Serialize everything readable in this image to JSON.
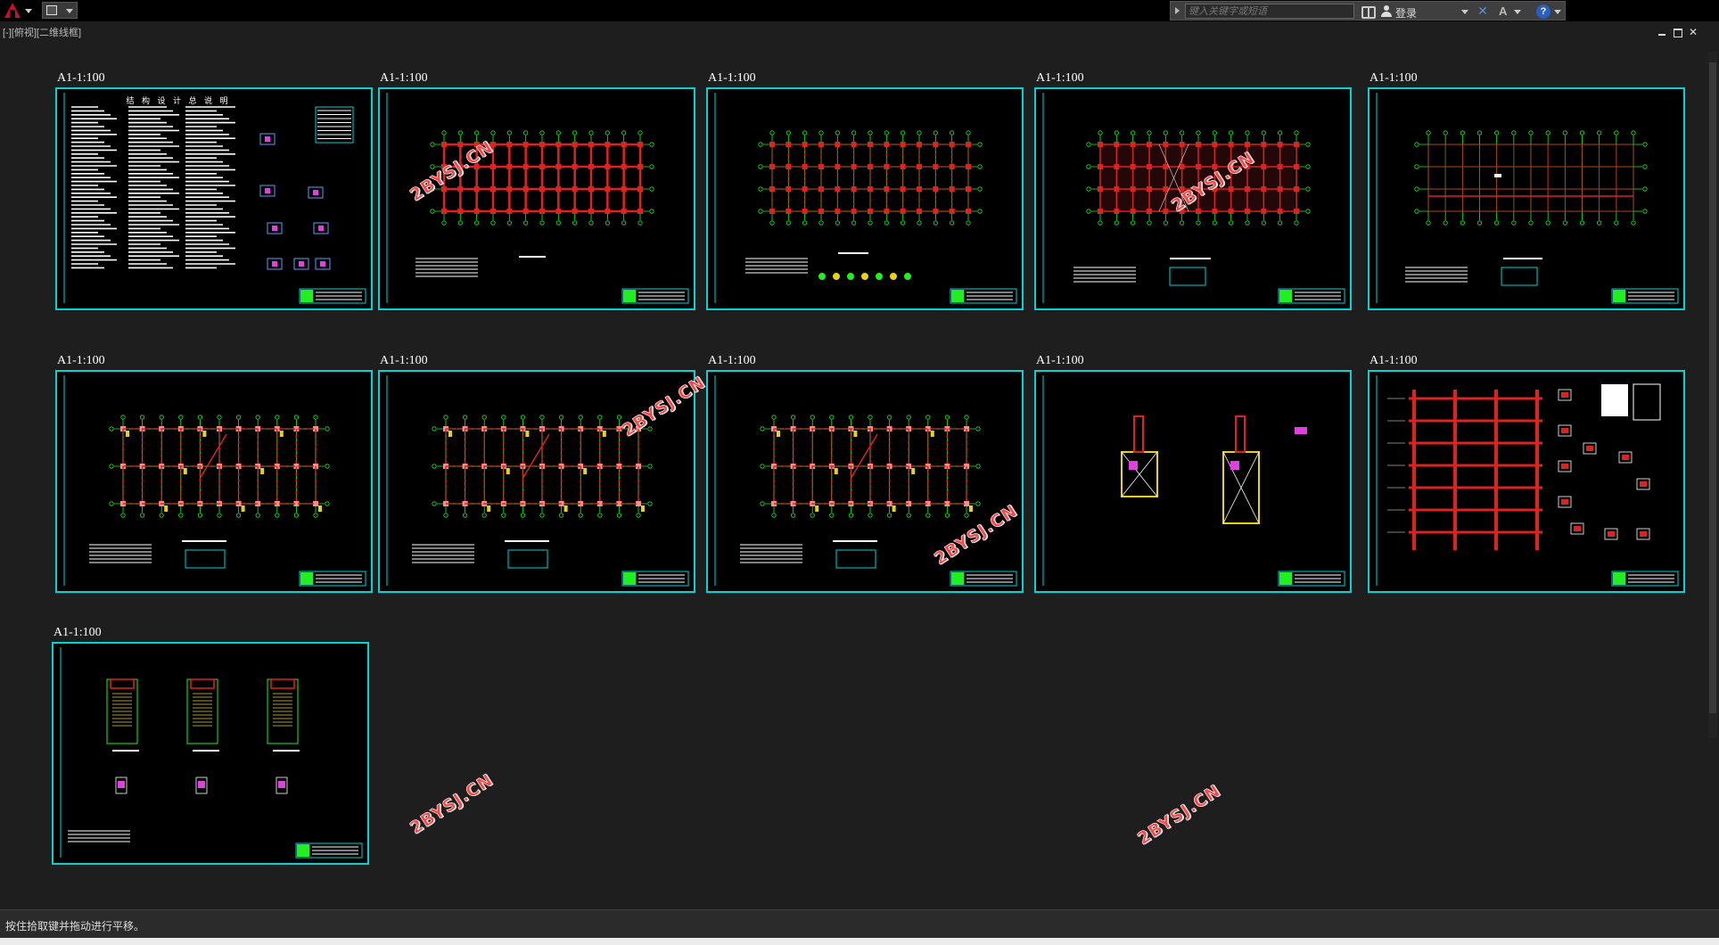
{
  "app": {
    "menu_icon": "autocad-a-logo",
    "quick_access_icon": "document-icon",
    "viewport_label": "[-][俯视][二维线框]",
    "window_controls": [
      "minimize-icon",
      "restore-icon",
      "close-icon"
    ],
    "close_glyph": "✕"
  },
  "info_center": {
    "search_placeholder": "键入关键字或短语",
    "login_label": "登录",
    "exchange_glyph": "✕",
    "a360_glyph": "A",
    "help_glyph": "?"
  },
  "sheets": [
    {
      "scale": "A1-1:100",
      "kind": "notes",
      "title": "结 构 设 计 总 说 明"
    },
    {
      "scale": "A1-1:100",
      "kind": "plan-columns"
    },
    {
      "scale": "A1-1:100",
      "kind": "plan-foundation"
    },
    {
      "scale": "A1-1:100",
      "kind": "plan-beams-red"
    },
    {
      "scale": "A1-1:100",
      "kind": "plan-slab"
    },
    {
      "scale": "A1-1:100",
      "kind": "plan-reinforce"
    },
    {
      "scale": "A1-1:100",
      "kind": "plan-reinforce"
    },
    {
      "scale": "A1-1:100",
      "kind": "plan-reinforce"
    },
    {
      "scale": "A1-1:100",
      "kind": "stair-detail"
    },
    {
      "scale": "A1-1:100",
      "kind": "frame-elevation"
    },
    {
      "scale": "A1-1:100",
      "kind": "stair-plans"
    }
  ],
  "watermark_text": "2BYSJ.CN",
  "status": {
    "prompt": "按住拾取键并拖动进行平移。"
  },
  "colors": {
    "background": "#1e1e1e",
    "sheet_border": "#00d4d4",
    "grid_green": "#22ee22",
    "beam_red": "#dd2222",
    "watermark": "#ff4444"
  }
}
